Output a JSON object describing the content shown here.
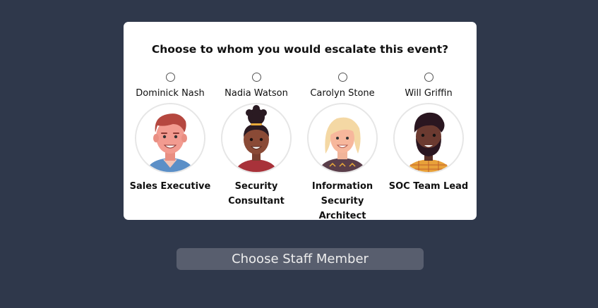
{
  "question": "Choose to whom you would escalate this event?",
  "staff": [
    {
      "name": "Dominick Nash",
      "role": "Sales Executive",
      "avatar_icon": "man-red-hair-avatar-icon",
      "selected": false
    },
    {
      "name": "Nadia Watson",
      "role": "Security Consultant",
      "avatar_icon": "woman-dark-hair-bun-avatar-icon",
      "selected": false
    },
    {
      "name": "Carolyn Stone",
      "role": "Information Security Architect",
      "avatar_icon": "woman-blonde-hair-avatar-icon",
      "selected": false
    },
    {
      "name": "Will Griffin",
      "role": "SOC Team Lead",
      "avatar_icon": "man-beard-avatar-icon",
      "selected": false
    }
  ],
  "button_label": "Choose Staff Member",
  "colors": {
    "background": "#2f384b",
    "card": "#ffffff",
    "button": "#585e6e"
  }
}
